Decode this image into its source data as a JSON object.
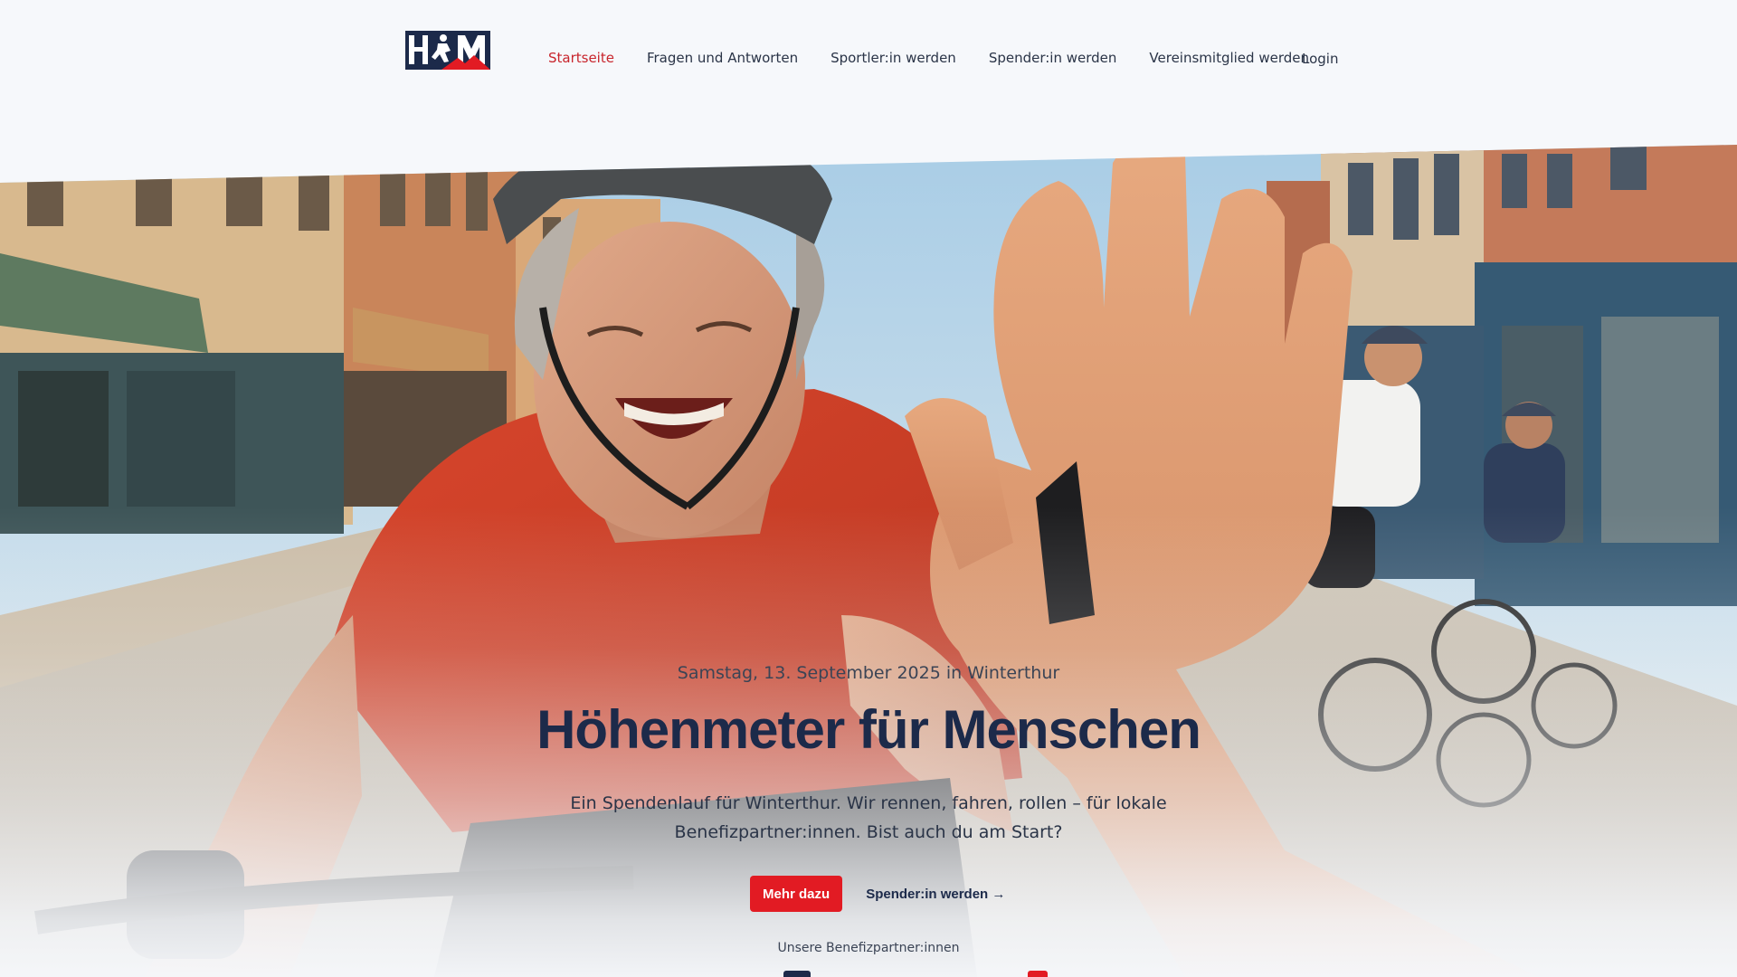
{
  "header": {
    "logo_text": "HfM",
    "nav": [
      {
        "label": "Startseite",
        "active": true
      },
      {
        "label": "Fragen und Antworten",
        "active": false
      },
      {
        "label": "Sportler:in werden",
        "active": false
      },
      {
        "label": "Spender:in werden",
        "active": false
      },
      {
        "label": "Vereinsmitglied werden",
        "active": false
      }
    ],
    "login_label": "Login"
  },
  "hero": {
    "date": "Samstag, 13. September 2025 in Winterthur",
    "title": "Höhenmeter für Menschen",
    "lead": "Ein Spendenlauf für Winterthur. Wir rennen, fahren, rollen – für lokale Benefizpartner:innen. Bist auch du am Start?",
    "primary_button": "Mehr dazu",
    "secondary_link": "Spender:in werden →",
    "partners_label": "Unsere Benefizpartner:innen"
  },
  "colors": {
    "accent": "#e21b23",
    "nav_active": "#c8252c",
    "navy": "#1c2a4a",
    "page_bg": "#f6f8fb"
  },
  "icons": [
    "arrow-right-icon",
    "logo-runner-mark"
  ]
}
